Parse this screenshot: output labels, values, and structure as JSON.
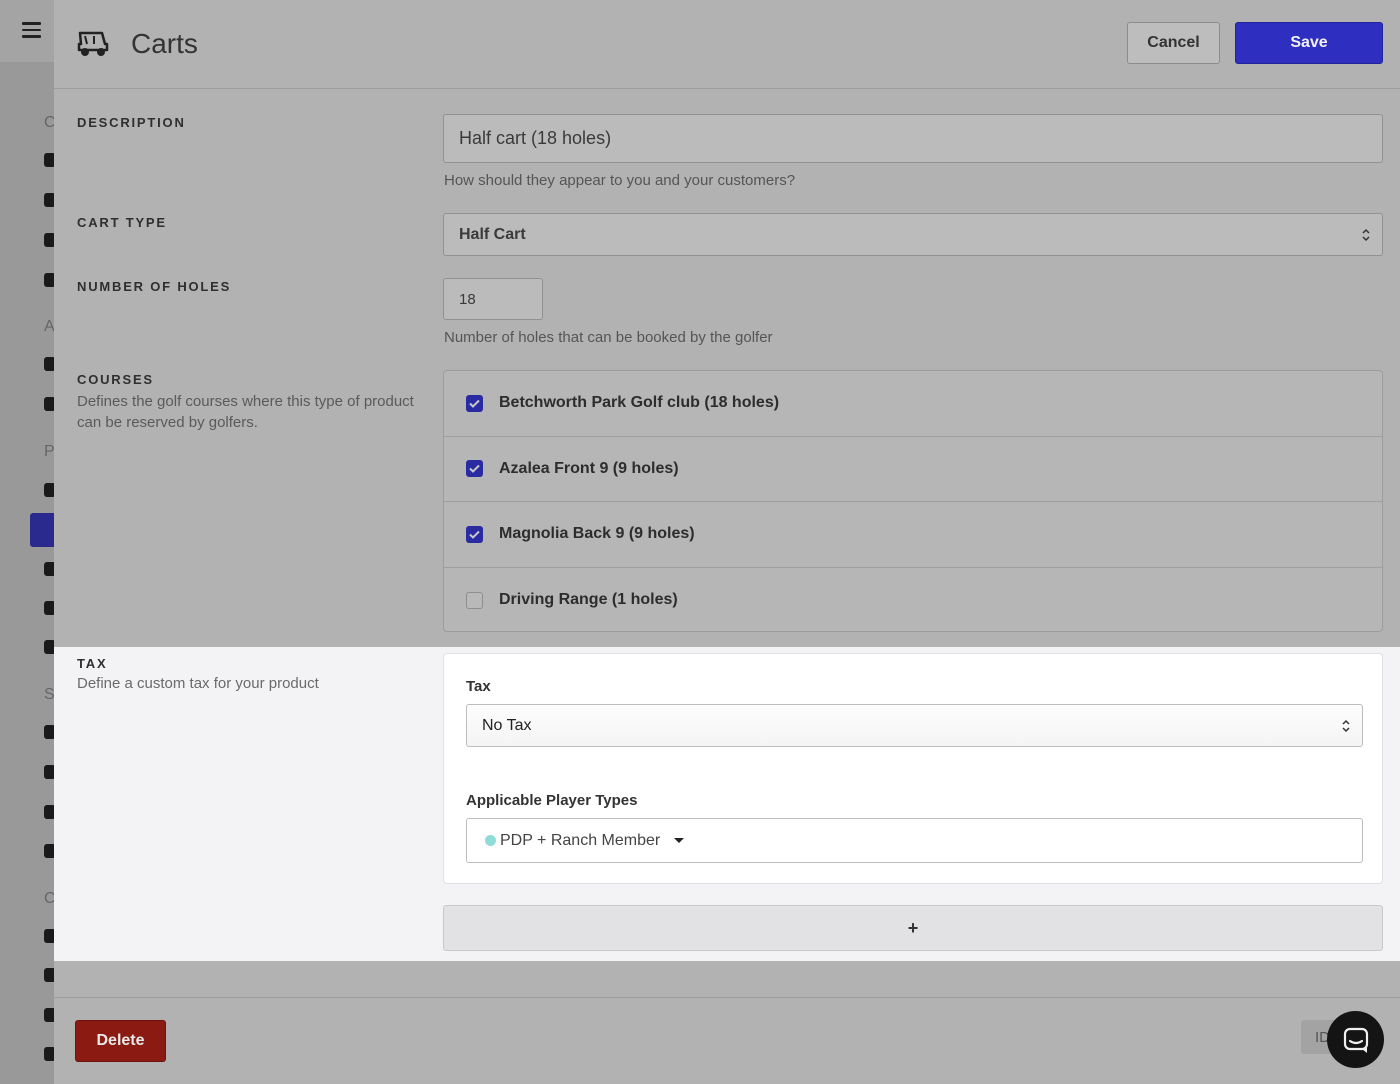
{
  "header": {
    "title": "Carts",
    "cancel_label": "Cancel",
    "save_label": "Save"
  },
  "sidebar": {
    "section_letters": [
      "C",
      "A",
      "P",
      "S",
      "C"
    ]
  },
  "form": {
    "description": {
      "label": "DESCRIPTION",
      "value": "Half cart (18 holes)",
      "help": "How should they appear to you and your customers?"
    },
    "cart_type": {
      "label": "CART TYPE",
      "value": "Half Cart"
    },
    "holes": {
      "label": "NUMBER OF HOLES",
      "value": "18",
      "help": "Number of holes that can be booked by the golfer"
    },
    "courses": {
      "label": "COURSES",
      "description": "Defines the golf courses where this type of product can be reserved by golfers.",
      "items": [
        {
          "label": "Betchworth Park Golf club (18 holes)",
          "checked": true
        },
        {
          "label": "Azalea Front 9 (9 holes)",
          "checked": true
        },
        {
          "label": "Magnolia Back 9 (9 holes)",
          "checked": true
        },
        {
          "label": "Driving Range (1 holes)",
          "checked": false
        }
      ]
    },
    "tax": {
      "label": "TAX",
      "description": "Define a custom tax for your product",
      "field_label": "Tax",
      "value": "No Tax",
      "player_types_label": "Applicable Player Types",
      "player_type": "PDP + Ranch Member",
      "player_type_color": "#8fdcd6",
      "add_label": "+"
    }
  },
  "footer": {
    "delete_label": "Delete",
    "id_label": "ID"
  },
  "colors": {
    "primary": "#2e2ec0",
    "danger": "#8b1a12"
  }
}
